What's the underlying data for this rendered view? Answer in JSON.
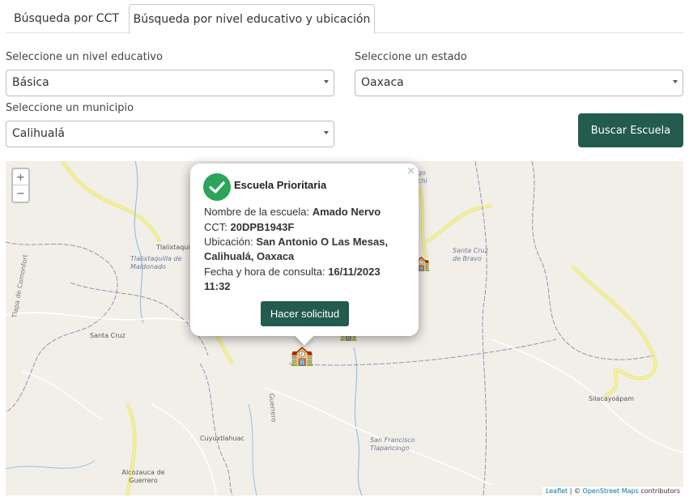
{
  "tabs": [
    {
      "label": "Búsqueda por CCT",
      "active": false
    },
    {
      "label": "Búsqueda por nivel educativo y ubicación",
      "active": true
    }
  ],
  "form": {
    "nivel_label": "Seleccione un nivel educativo",
    "nivel_value": "Básica",
    "estado_label": "Seleccione un estado",
    "estado_value": "Oaxaca",
    "municipio_label": "Seleccione un municipio",
    "municipio_value": "Calihualá",
    "search_button": "Buscar Escuela"
  },
  "map": {
    "zoom_in": "+",
    "zoom_out": "−",
    "places": {
      "tlalixtaquilla": "Tlalixtaquilla de Maldonado",
      "tlalixtaqui": "Tlalixtaqui",
      "santa_cruz": "Santa Cruz",
      "cuyuxtlahuac": "Cuyuxtlahuac",
      "alcozauca": "Alcozauca de Guerrero",
      "guerrero_road": "Guerrero",
      "tlapa": "Tlapa de Comonfort",
      "santa_cruz_bravo": "Santa Cruz de Bravo",
      "silacayoapam": "Silacayoápam",
      "san_francisco": "San Francisco Tlapancingo",
      "ago_achi": "ago achi"
    },
    "attribution": {
      "leaflet": "Leaflet",
      "separator": " | © ",
      "osm": "OpenStreet Maps",
      "contributors": " contributors"
    }
  },
  "popup": {
    "close": "×",
    "title": "Escuela Prioritaria",
    "nombre_label": "Nombre de la escuela: ",
    "nombre_value": "Amado Nervo",
    "cct_label": "CCT: ",
    "cct_value": "20DPB1943F",
    "ubicacion_label": "Ubicación: ",
    "ubicacion_value_1": "San Antonio O Las Mesas,",
    "ubicacion_value_2": "Calihualá, Oaxaca",
    "fecha_label": "Fecha y hora de consulta: ",
    "fecha_value_1": "16/11/2023",
    "fecha_value_2": "11:32",
    "button": "Hacer solicitud"
  },
  "colors": {
    "primary": "#235b4e",
    "check": "#2aa55a",
    "map_bg": "#f2efe9",
    "road_yellow": "#f7f396",
    "border_purple": "#a08ab0",
    "river_blue": "#8fc3e6"
  }
}
